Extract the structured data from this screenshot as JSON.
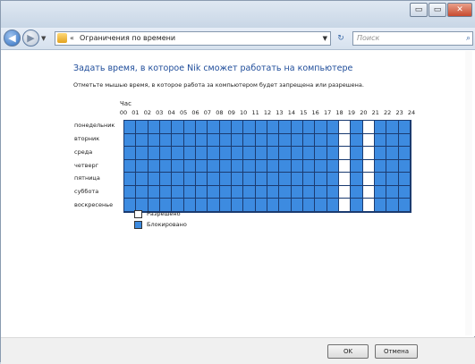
{
  "window": {
    "controls": {
      "minimize": "▭",
      "maximize": "▭",
      "close": "✕"
    }
  },
  "navigation": {
    "address_icon": "folder-icon",
    "breadcrumb_chevron": "«",
    "address_path": "Ограничения по времени",
    "search_placeholder": "Поиск"
  },
  "page": {
    "heading": "Задать время, в которое Nik сможет работать на компьютере",
    "instruction": "Отметьте мышью время, в которое работа за компьютером будет запрещена или разрешена.",
    "hour_label": "Час",
    "hours": [
      "00",
      "01",
      "02",
      "03",
      "04",
      "05",
      "06",
      "07",
      "08",
      "09",
      "10",
      "11",
      "12",
      "13",
      "14",
      "15",
      "16",
      "17",
      "18",
      "19",
      "20",
      "21",
      "22",
      "23",
      "24"
    ],
    "days": [
      "понедельник",
      "вторник",
      "среда",
      "четверг",
      "пятница",
      "суббота",
      "воскресенье"
    ],
    "allowed_hours": [
      18,
      20
    ],
    "colors": {
      "blocked": "#3d8be0",
      "allowed": "#ffffff",
      "grid_line": "#1b3b70"
    }
  },
  "legend": {
    "allowed_label": "Разрешено",
    "blocked_label": "Блокировано"
  },
  "buttons": {
    "ok": "OK",
    "cancel": "Отмена"
  }
}
